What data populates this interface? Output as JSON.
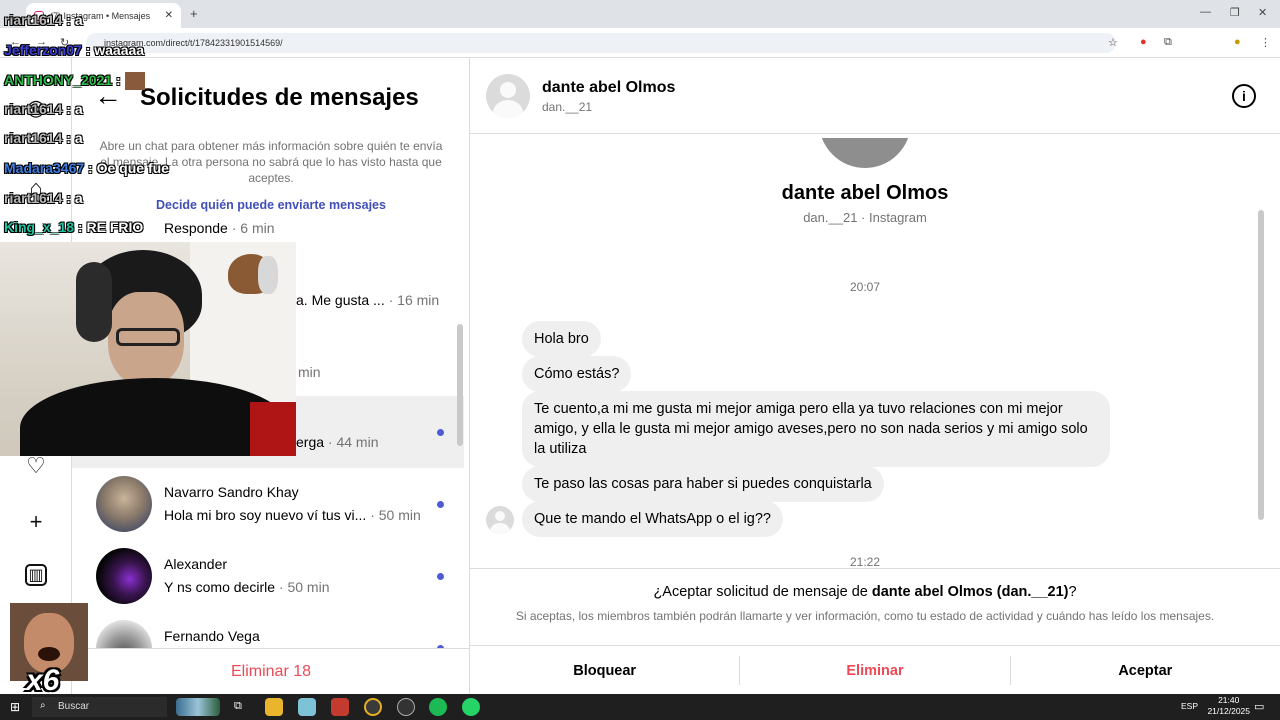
{
  "browser": {
    "tab_title": "(7) Instagram • Mensajes",
    "url": "instagram.com/direct/t/17842331901514569/"
  },
  "requests": {
    "title": "Solicitudes de mensajes",
    "description": "Abre un chat para obtener más información sobre quién te envía el mensaje. La otra persona no sabrá que lo has visto hasta que aceptes.",
    "link": "Decide quién puede enviarte mensajes",
    "items": [
      {
        "name": "",
        "msg": "Responde",
        "time": " · 6 min"
      },
      {
        "name": "",
        "msg": "a. Me gusta ...",
        "time": " · 16 min"
      },
      {
        "name": "",
        "msg": "",
        "time": "min"
      },
      {
        "name": "",
        "msg": "erga",
        "time": " · 44 min"
      },
      {
        "name": "Navarro Sandro Khay",
        "msg": "Hola mi bro soy nuevo ví tus vi...",
        "time": " · 50 min"
      },
      {
        "name": "Alexander",
        "msg": "Y ns como decirle",
        "time": " · 50 min"
      },
      {
        "name": "Fernando Vega",
        "msg": "",
        "time": ""
      }
    ],
    "delete_all": "Eliminar 18"
  },
  "chat": {
    "name": "dante abel Olmos",
    "username": "dan.__21",
    "profile_sub": "dan.__21 · Instagram",
    "time1": "20:07",
    "time2": "21:22",
    "messages": [
      "Hola bro",
      "Cómo estás?",
      "Te cuento,a mi me gusta mi mejor amiga pero ella ya tuvo relaciones con mi mejor amigo, y ella le gusta mi mejor amigo aveses,pero no son nada serios y mi amigo solo la utiliza",
      "Te paso las cosas para haber si puedes conquistarla",
      "Que te mando el WhatsApp o el ig??"
    ],
    "accept_question_prefix": "¿Aceptar solicitud de mensaje de ",
    "accept_question_bold": "dante abel Olmos (dan.__21)",
    "accept_question_suffix": "?",
    "accept_info": "Si aceptas, los miembros también podrán llamarte y ver información, como tu estado de actividad y cuándo has leído los mensajes.",
    "btn_block": "Bloquear",
    "btn_delete": "Eliminar",
    "btn_accept": "Aceptar"
  },
  "stream_chat": [
    {
      "user": "riart1614",
      "msg": " : a",
      "color": "#b9b9b9"
    },
    {
      "user": "Jefferzon07",
      "msg": " : waaaaa",
      "color": "#3b3fd6"
    },
    {
      "user": "ANTHONY_2021",
      "msg": " : ",
      "color": "#2ebd4a"
    },
    {
      "user": "riart1614",
      "msg": " : a",
      "color": "#b9b9b9"
    },
    {
      "user": "riart1614",
      "msg": " : a",
      "color": "#b9b9b9"
    },
    {
      "user": "Madara3467",
      "msg": " : Oe que fue",
      "color": "#3e7de0"
    },
    {
      "user": "riart1614",
      "msg": " : a",
      "color": "#b9b9b9"
    },
    {
      "user": "King_x_18",
      "msg": " : RE FRIO",
      "color": "#20c2a0"
    }
  ],
  "emote_count": "x6",
  "taskbar": {
    "search": "Buscar",
    "lang": "ESP",
    "time": "21:40",
    "date": "21/12/2025"
  },
  "colors": {
    "instagram_link": "#4150b8",
    "danger": "#ed4956",
    "unread_dot": "#4f5bd5"
  }
}
